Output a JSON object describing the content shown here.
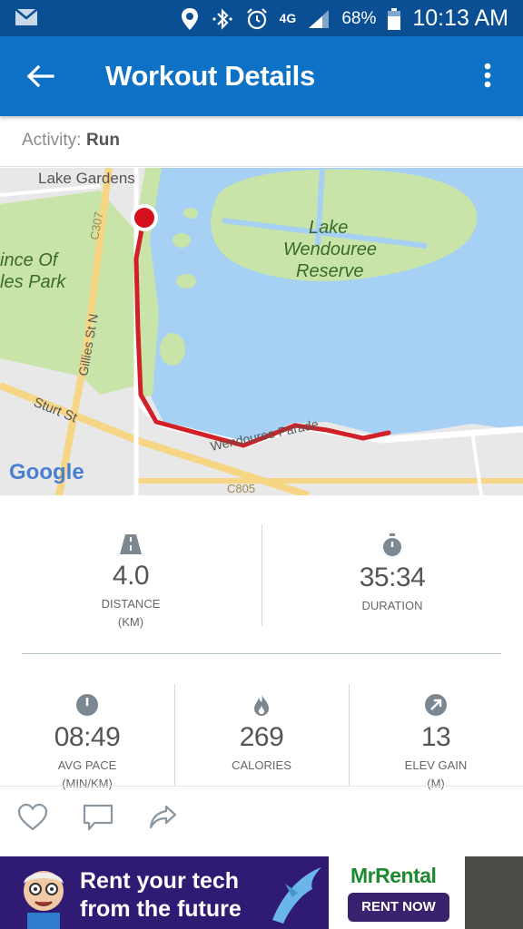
{
  "status_bar": {
    "network": "4G",
    "battery": "68%",
    "time": "10:13 AM"
  },
  "app_bar": {
    "title": "Workout Details"
  },
  "activity": {
    "label": "Activity:",
    "value": "Run"
  },
  "map": {
    "labels": {
      "lake_gardens": "Lake Gardens",
      "c307": "C307",
      "prince_of_wales_1": "ince Of",
      "prince_of_wales_2": "les Park",
      "gillies": "Gillies St N",
      "lake_1": "Lake",
      "lake_2": "Wendouree",
      "lake_3": "Reserve",
      "sturt": "Sturt St",
      "wendouree_parade": "Wendouree Parade",
      "c805": "C805",
      "google": "Google"
    },
    "colors": {
      "water": "#a7d0f5",
      "land": "#e8e8e8",
      "park": "#c8e4a8",
      "route": "#d12027"
    }
  },
  "stats": {
    "distance": {
      "value": "4.0",
      "label": "DISTANCE",
      "unit": "(KM)",
      "icon": "road-icon"
    },
    "duration": {
      "value": "35:34",
      "label": "DURATION",
      "icon": "stopwatch-icon"
    },
    "avg_pace": {
      "value": "08:49",
      "label": "AVG PACE",
      "unit": "(MIN/KM)",
      "icon": "speedometer-icon"
    },
    "calories": {
      "value": "269",
      "label": "CALORIES",
      "icon": "flame-icon"
    },
    "elev_gain": {
      "value": "13",
      "label": "ELEV GAIN",
      "unit": "(M)",
      "icon": "arrow-up-right-icon"
    }
  },
  "ad": {
    "headline_1": "Rent your tech",
    "headline_2": "from the future",
    "brand": "MrRental",
    "cta": "RENT NOW"
  },
  "colors": {
    "status_bar": "#0a4f93",
    "app_bar": "#0d72c6",
    "icon_gray": "#7b8791"
  }
}
